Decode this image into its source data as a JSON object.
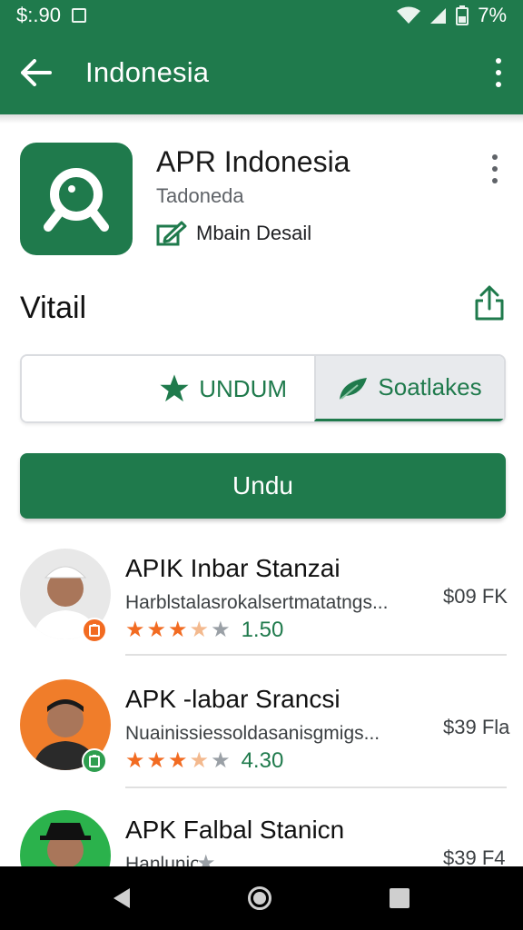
{
  "status_bar": {
    "time": "$:.90",
    "battery": "7%"
  },
  "app_bar": {
    "title": "Indonesia"
  },
  "app_header": {
    "name": "APR Indonesia",
    "subtitle": "Tadoneda",
    "developer_label": "Mbain Desail"
  },
  "section": {
    "title": "Vitail"
  },
  "segmented": {
    "option_a": "UNDUM",
    "option_b": "Soatlakes"
  },
  "primary_button": {
    "label": "Undu"
  },
  "list": [
    {
      "name": "APIK Inbar Stanzai",
      "desc": "Harblstalasrokalsertmatatngs...",
      "price": "$09 FK",
      "rating": "1.50",
      "rating_fraction": 0.6,
      "badge_color": "#f26b21",
      "avatar_bg": "#e8e8e8"
    },
    {
      "name": "APK -labar Srancsi",
      "desc": "Nuainissiessoldasanisgmigs...",
      "price": "$39 Fla",
      "rating": "4.30",
      "rating_fraction": 0.6,
      "badge_color": "#2e9e4f",
      "avatar_bg": "#f07d2a"
    },
    {
      "name": "APK Falbal Stanicn",
      "desc": "Hanlunio",
      "price": "$39 F4",
      "rating": "",
      "rating_fraction": 0,
      "badge_color": "#2e9e4f",
      "avatar_bg": "#2bb24c"
    }
  ],
  "colors": {
    "primary": "#1f7a4c",
    "star": "#f26b21",
    "rating_text": "#1f7a4c"
  },
  "icons": [
    "back-arrow-icon",
    "more-vert-icon",
    "magnifier-logo-icon",
    "edit-icon",
    "share-icon",
    "star-icon",
    "leaf-icon",
    "nav-back-icon",
    "nav-home-icon",
    "nav-recents-icon",
    "wifi-icon",
    "signal-icon",
    "battery-icon"
  ]
}
